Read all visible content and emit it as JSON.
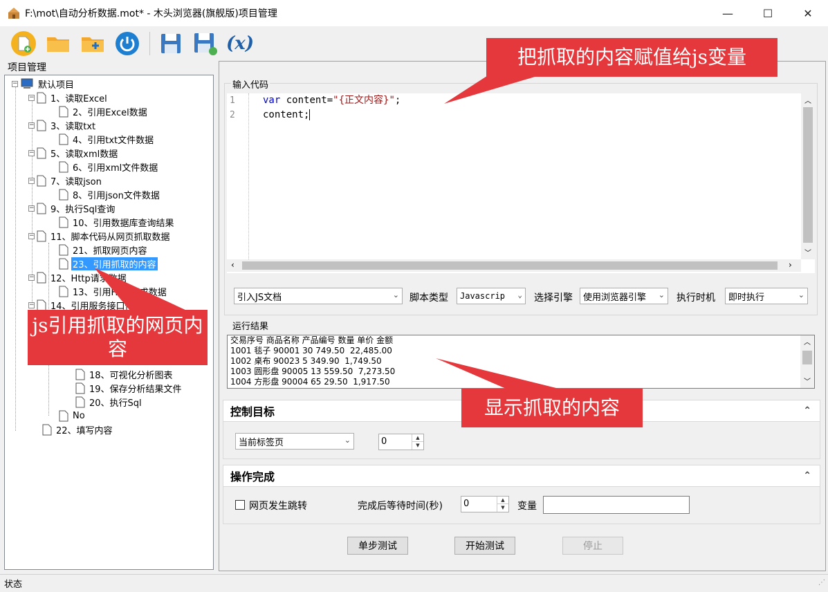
{
  "window": {
    "title": "F:\\mot\\自动分析数据.mot* - 木头浏览器(旗舰版)项目管理",
    "min_glyph": "—",
    "max_glyph": "☐",
    "close_glyph": "✕"
  },
  "toolbar": {
    "fx_label": "(x)"
  },
  "project_panel": {
    "title": "项目管理",
    "root": "默认项目",
    "items": [
      "1、读取Excel",
      "2、引用Excel数据",
      "3、读取txt",
      "4、引用txt文件数据",
      "5、读取xml数据",
      "6、引用xml文件数据",
      "7、读取json",
      "8、引用json文件数据",
      "9、执行Sql查询",
      "10、引用数据库查询结果",
      "11、脚本代码从网页抓取数据",
      "21、抓取网页内容",
      "23、引用抓取的内容",
      "12、Http请求数据",
      "13、引用Http请求数据",
      "14、引用服务接口传入数据",
      "18、可视化分析图表",
      "19、保存分析结果文件",
      "20、执行Sql",
      "No",
      "22、填写内容"
    ]
  },
  "code_editor": {
    "group_label": "输入代码",
    "line_numbers": [
      "1",
      "2"
    ],
    "line1_kw": "var",
    "line1_mid": " content=",
    "line1_str": "\"{正文内容}\"",
    "line1_end": ";",
    "line2": "content;"
  },
  "options_row": {
    "import_js": "引入JS文档",
    "script_type_label": "脚本类型",
    "script_type": "Javascrip",
    "engine_label": "选择引擎",
    "engine": "使用浏览器引擎",
    "timing_label": "执行时机",
    "timing": "即时执行"
  },
  "result": {
    "label": "运行结果",
    "lines": [
      "交易序号 商品名称 产品编号 数量 单价 金额",
      "1001 毯子 90001 30 749.50  22,485.00",
      "1002 桌布 90023 5 349.90  1,749.50",
      "1003 圆形盘 90005 13 559.50  7,273.50",
      "1004 方形盘 90004 65 29.50  1,917.50"
    ]
  },
  "control_target": {
    "title": "控制目标",
    "target": "当前标签页",
    "index_value": "0"
  },
  "op_complete": {
    "title": "操作完成",
    "redirect_label": "网页发生跳转",
    "wait_label": "完成后等待时间(秒)",
    "wait_value": "0",
    "var_label": "变量",
    "var_value": ""
  },
  "actions": {
    "step_test": "单步测试",
    "start_test": "开始测试",
    "stop": "停止"
  },
  "status": {
    "text": "状态"
  },
  "callouts": {
    "js_assign": "把抓取的内容赋值给js变量",
    "js_ref": "js引用抓取的网页内容",
    "show_content": "显示抓取的内容"
  },
  "colors": {
    "callout": "#e4383c",
    "selection": "#3399ff",
    "keyword": "#0000c0",
    "string": "#a31515"
  }
}
